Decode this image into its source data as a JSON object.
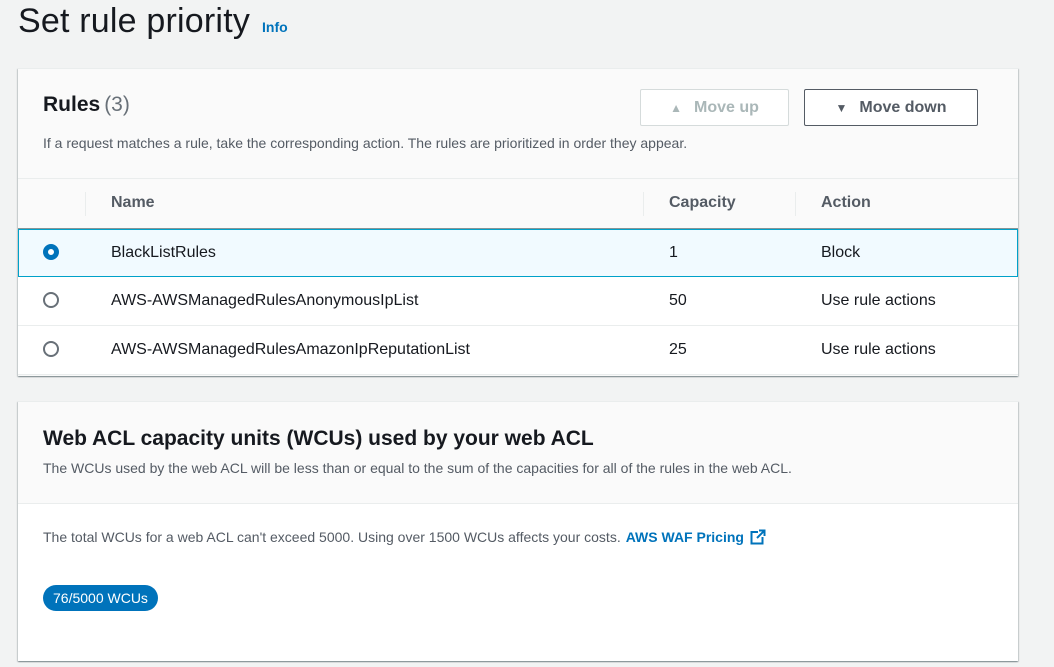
{
  "page": {
    "title": "Set rule priority",
    "info_label": "Info"
  },
  "rules": {
    "title": "Rules",
    "count": "(3)",
    "description": "If a request matches a rule, take the corresponding action. The rules are prioritized in order they appear.",
    "move_up_label": "Move up",
    "move_down_label": "Move down",
    "move_up_disabled": true,
    "columns": {
      "name": "Name",
      "capacity": "Capacity",
      "action": "Action"
    },
    "rows": [
      {
        "name": "BlackListRules",
        "capacity": "1",
        "action": "Block",
        "selected": true
      },
      {
        "name": "AWS-AWSManagedRulesAnonymousIpList",
        "capacity": "50",
        "action": "Use rule actions",
        "selected": false
      },
      {
        "name": "AWS-AWSManagedRulesAmazonIpReputationList",
        "capacity": "25",
        "action": "Use rule actions",
        "selected": false
      }
    ]
  },
  "wcu": {
    "title": "Web ACL capacity units (WCUs) used by your web ACL",
    "description": "The WCUs used by the web ACL will be less than or equal to the sum of the capacities for all of the rules in the web ACL.",
    "limit_text": "The total WCUs for a web ACL can't exceed 5000. Using over 1500 WCUs affects your costs.",
    "pricing_link": "AWS WAF Pricing",
    "pricing_icon": "external-link-icon",
    "badge": "76/5000 WCUs"
  },
  "colors": {
    "accent": "#0073bb",
    "selected_row_bg": "#f1faff",
    "selected_row_border": "#00a1c9"
  }
}
